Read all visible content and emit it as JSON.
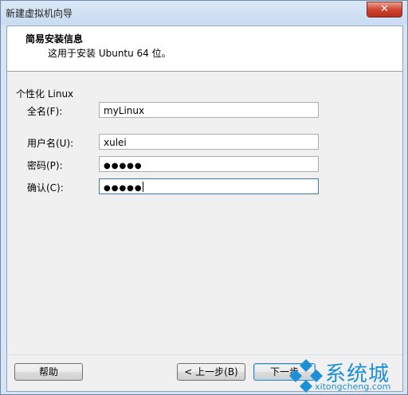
{
  "window": {
    "title": "新建虚拟机向导",
    "close_symbol": "✕"
  },
  "header": {
    "title": "简易安装信息",
    "subtitle": "这用于安装 Ubuntu 64 位。"
  },
  "section": {
    "label": "个性化 Linux"
  },
  "form": {
    "fullname": {
      "label": "全名(F):",
      "value": "myLinux"
    },
    "username": {
      "label": "用户名(U):",
      "value": "xulei"
    },
    "password": {
      "label": "密码(P):",
      "value": "●●●●●"
    },
    "confirm": {
      "label": "确认(C):",
      "value": "●●●●●"
    }
  },
  "buttons": {
    "help": "帮助",
    "back": "< 上一步(B)",
    "next": "下一步"
  },
  "watermark": {
    "brand": "系统城",
    "url": "xitongcheng.com"
  },
  "colors": {
    "accent": "#1d8fd6",
    "titlebar": "#c9dcf1",
    "close": "#d1442f"
  }
}
